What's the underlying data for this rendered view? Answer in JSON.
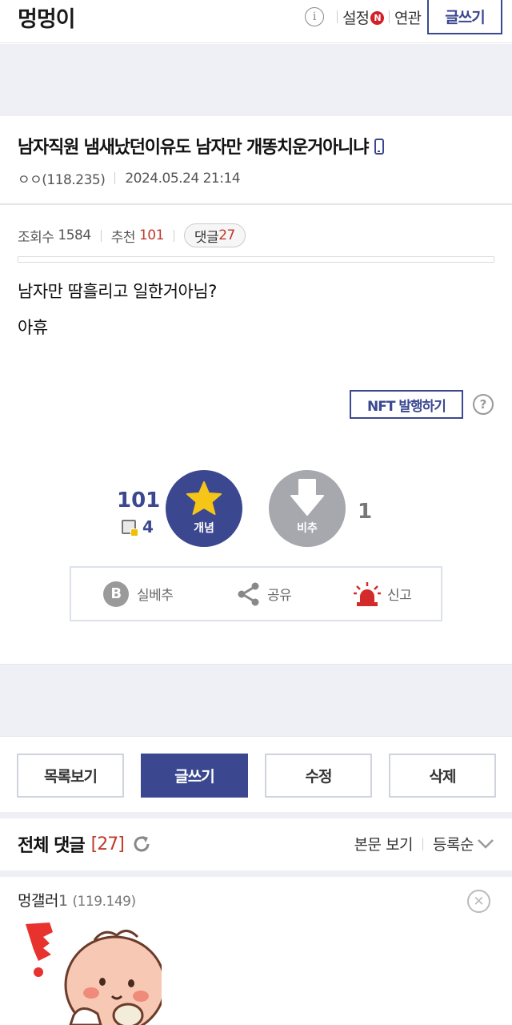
{
  "header": {
    "gallery_title": "멍멍이",
    "settings_label": "설정",
    "new_badge": "N",
    "related_label": "연관",
    "write_label": "글쓰기"
  },
  "post": {
    "title": "남자직원 냄새났던이유도 남자만 개똥치운거아니냐",
    "author": "ㅇㅇ(118.235)",
    "datetime": "2024.05.24 21:14",
    "views_label": "조회수",
    "views": "1584",
    "recommend_label": "추천",
    "recommend": "101",
    "comments_label": "댓글",
    "comments": "27",
    "body_lines": [
      "남자만 땀흘리고 일한거아님?",
      "아휴"
    ],
    "nft_label": "NFT 발행하기"
  },
  "recommend_box": {
    "up_count": "101",
    "fix_count": "4",
    "up_label": "개념",
    "down_label": "비추",
    "down_count": "1"
  },
  "actions": {
    "best_icon": "B",
    "best_label": "실베추",
    "share_label": "공유",
    "report_label": "신고"
  },
  "bottom_buttons": {
    "list": "목록보기",
    "write": "글쓰기",
    "edit": "수정",
    "delete": "삭제"
  },
  "comments_section": {
    "title": "전체 댓글",
    "count": "[27]",
    "view_body": "본문 보기",
    "sort": "등록순"
  },
  "first_comment": {
    "author": "멍갤러",
    "author_num": "1",
    "ip": "(119.149)"
  },
  "colors": {
    "accent": "#3b4890",
    "red": "#c0392b",
    "star": "#f5c518",
    "gray_band": "#eef0f5"
  }
}
